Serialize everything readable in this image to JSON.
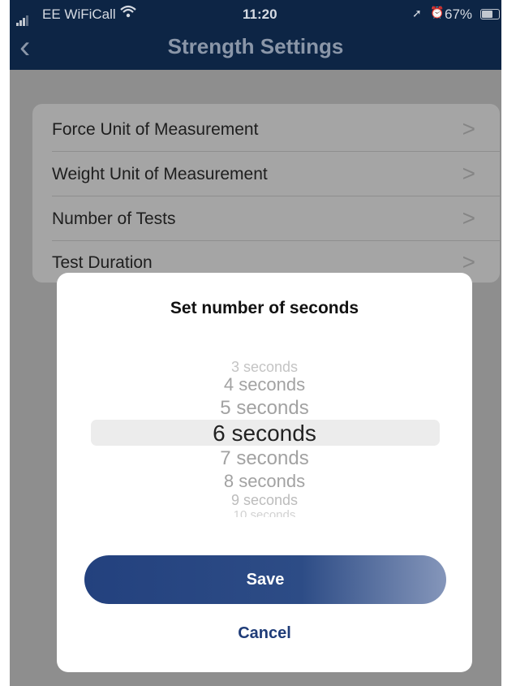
{
  "status_bar": {
    "carrier": "EE WiFiCall",
    "time": "11:20",
    "battery": "67%",
    "battery_level": 0.67
  },
  "nav": {
    "title": "Strength Settings"
  },
  "settings": [
    {
      "label": "Force Unit of Measurement"
    },
    {
      "label": "Weight Unit of Measurement"
    },
    {
      "label": "Number of Tests"
    },
    {
      "label": "Test Duration"
    }
  ],
  "dialog": {
    "title": "Set number of seconds",
    "options": [
      "3 seconds",
      "4 seconds",
      "5 seconds",
      "6 seconds",
      "7 seconds",
      "8 seconds",
      "9 seconds",
      "10 seconds"
    ],
    "selected": "6 seconds",
    "save_label": "Save",
    "cancel_label": "Cancel"
  }
}
